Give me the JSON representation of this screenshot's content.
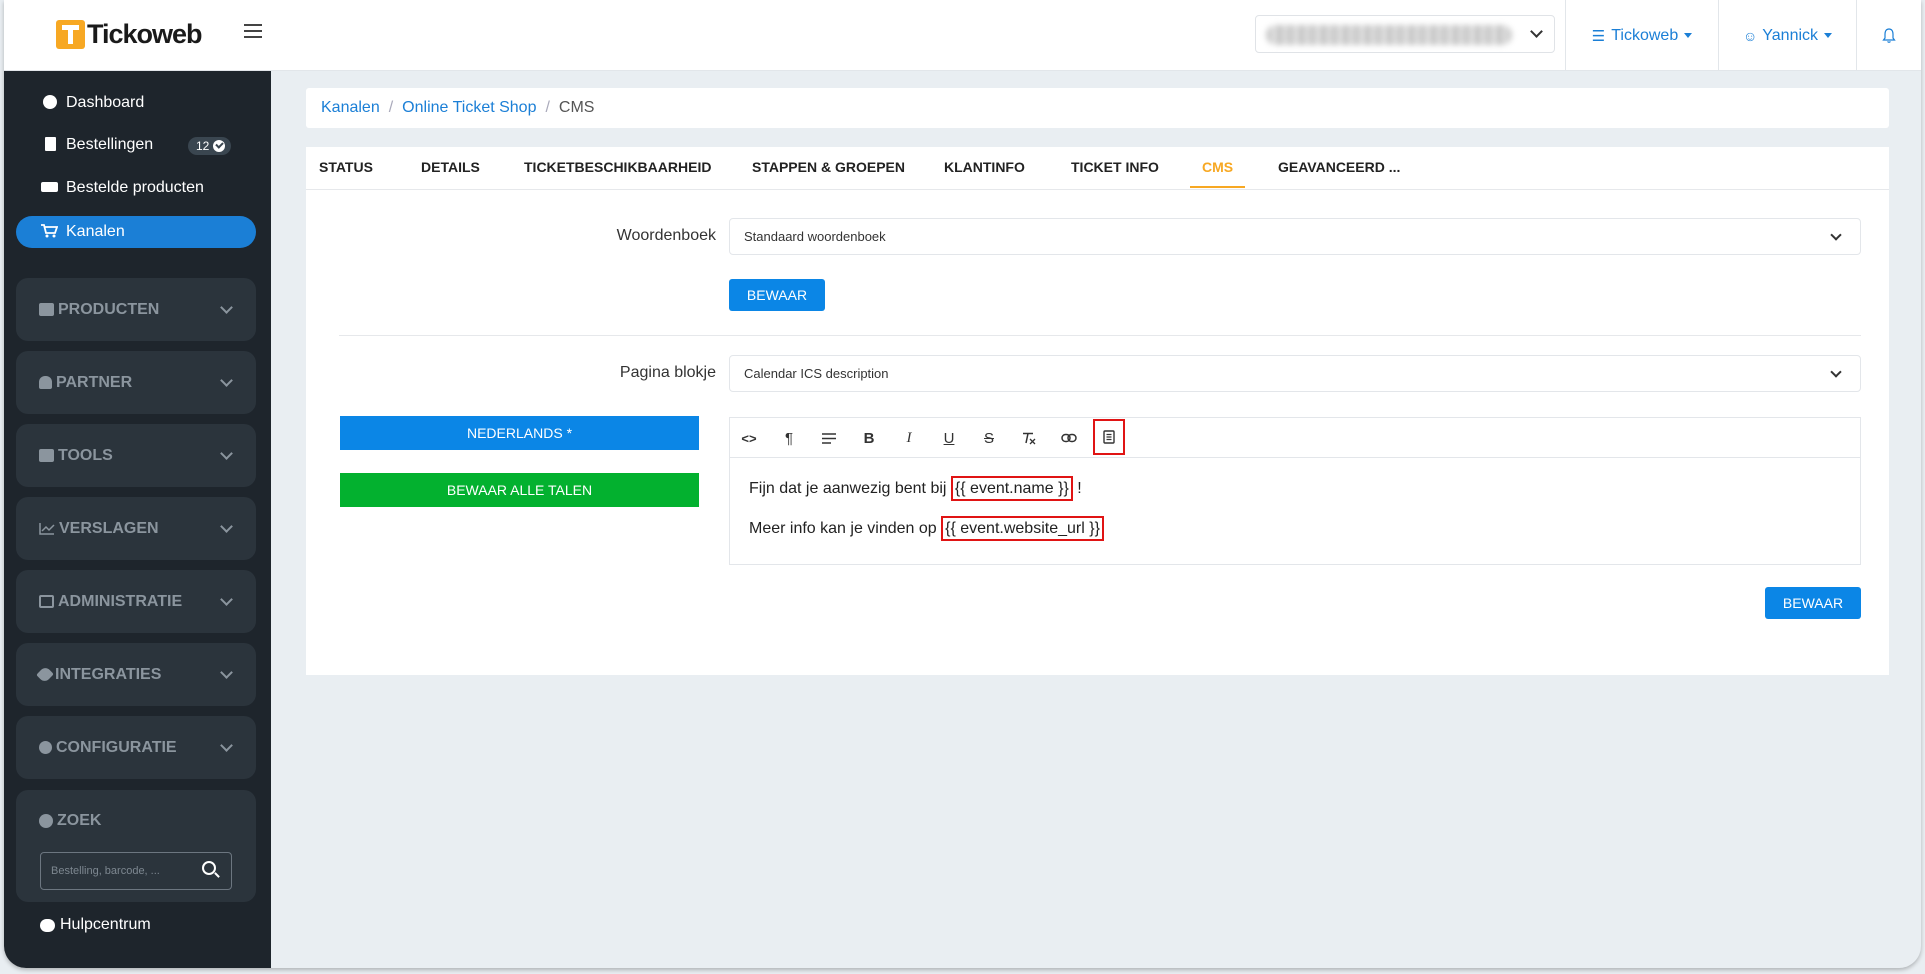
{
  "header": {
    "logo_text": "Tickoweb",
    "org_link": "Tickoweb",
    "user_link": "Yannick"
  },
  "sidebar": {
    "items": [
      {
        "label": "Dashboard"
      },
      {
        "label": "Bestellingen",
        "badge": "12"
      },
      {
        "label": "Bestelde producten"
      },
      {
        "label": "Kanalen"
      }
    ],
    "groups": [
      {
        "label": "PRODUCTEN"
      },
      {
        "label": "PARTNER"
      },
      {
        "label": "TOOLS"
      },
      {
        "label": "VERSLAGEN"
      },
      {
        "label": "ADMINISTRATIE"
      },
      {
        "label": "INTEGRATIES"
      },
      {
        "label": "CONFIGURATIE"
      }
    ],
    "search": {
      "title": "ZOEK",
      "placeholder": "Bestelling, barcode, ..."
    },
    "help": "Hulpcentrum"
  },
  "breadcrumb": {
    "items": [
      "Kanalen",
      "Online Ticket Shop"
    ],
    "current": "CMS"
  },
  "tabs": [
    "STATUS",
    "DETAILS",
    "TICKETBESCHIKBAARHEID",
    "STAPPEN & GROEPEN",
    "KLANTINFO",
    "TICKET INFO",
    "CMS",
    "GEAVANCEERD ..."
  ],
  "form": {
    "dictionary_label": "Woordenboek",
    "dictionary_value": "Standaard woordenboek",
    "save_label": "BEWAAR",
    "block_label": "Pagina blokje",
    "block_value": "Calendar ICS description",
    "language_button": "NEDERLANDS *",
    "save_all_button": "BEWAAR ALLE TALEN",
    "save_bottom": "BEWAAR"
  },
  "editor": {
    "line1_prefix": "Fijn dat je aanwezig bent bij ",
    "line1_var": "{{ event.name }}",
    "line1_suffix": " !",
    "line2_prefix": "Meer info kan je vinden op ",
    "line2_var": "{{ event.website_url }}"
  },
  "colors": {
    "primary": "#0b86e6",
    "accent": "#f7a823",
    "success": "#03b12f",
    "sidebar_bg": "#1e252c",
    "highlight": "#e01414"
  }
}
